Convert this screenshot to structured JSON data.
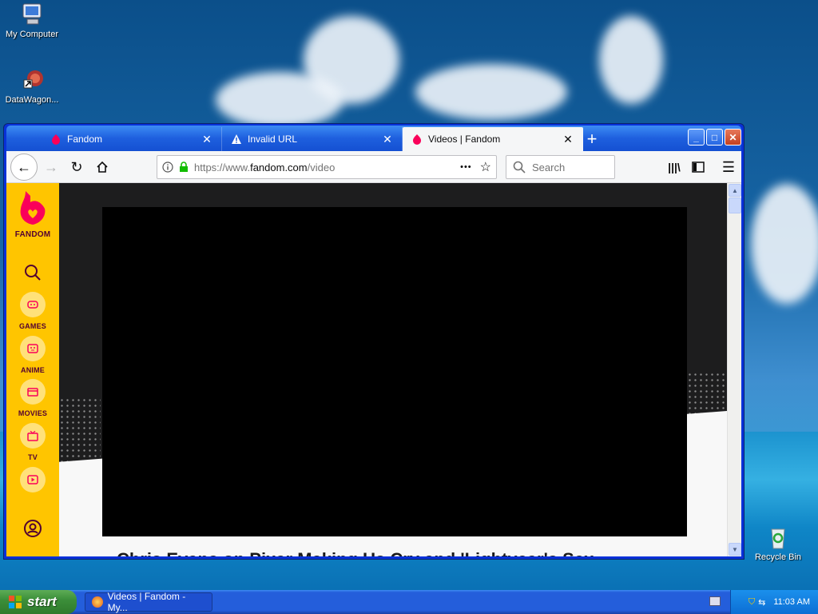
{
  "desktop": {
    "icons": [
      {
        "label": "My Computer"
      },
      {
        "label": "DataWagon..."
      },
      {
        "label": "Recycle Bin"
      }
    ]
  },
  "browser": {
    "tabs": [
      {
        "title": "Fandom",
        "icon": "fandom-flame-icon",
        "active": false
      },
      {
        "title": "Invalid URL",
        "icon": "warning-icon",
        "active": false
      },
      {
        "title": "Videos | Fandom",
        "icon": "fandom-flame-icon",
        "active": true
      }
    ],
    "new_tab": "+",
    "url": {
      "prefix": "https://www.",
      "domain": "fandom.com",
      "path": "/video"
    },
    "search_placeholder": "Search",
    "page_actions": "•••"
  },
  "page": {
    "logo_text": "FANDOM",
    "nav": [
      {
        "label": "GAMES",
        "icon": "games-icon"
      },
      {
        "label": "ANIME",
        "icon": "anime-icon"
      },
      {
        "label": "MOVIES",
        "icon": "movies-icon"
      },
      {
        "label": "TV",
        "icon": "tv-icon"
      },
      {
        "label": "",
        "icon": "video-icon"
      }
    ],
    "video_title": "Chris Evans on Pixar Making Us Cry and 'Lightyear's Sex"
  },
  "taskbar": {
    "start_label": "start",
    "task_label": "Videos | Fandom - My...",
    "clock": "11:03 AM"
  },
  "colors": {
    "fandom_yellow": "#ffc500",
    "fandom_magenta": "#fa005a",
    "fandom_dark": "#520032",
    "xp_blue": "#245edb",
    "start_green": "#3c8f3a"
  }
}
